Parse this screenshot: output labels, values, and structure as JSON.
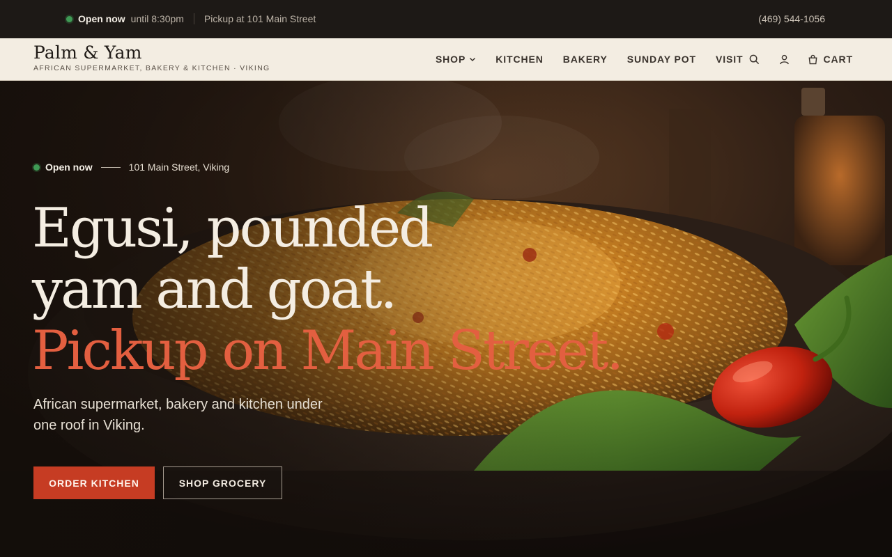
{
  "topbar": {
    "status_open": "Open now",
    "status_until": "until 8:30pm",
    "pickup": "Pickup at 101 Main Street",
    "phone": "(469) 544-1056"
  },
  "header": {
    "brand_name": "Palm & Yam",
    "brand_tagline": "AFRICAN SUPERMARKET, BAKERY & KITCHEN · VIKING",
    "nav": {
      "shop": "SHOP",
      "kitchen": "KITCHEN",
      "bakery": "BAKERY",
      "sunday_pot": "SUNDAY POT",
      "visit": "VISIT",
      "cart": "CART"
    }
  },
  "hero": {
    "eyebrow_open": "Open now",
    "eyebrow_address": "101 Main Street, Viking",
    "headline_line1": "Egusi, pounded",
    "headline_line2": "yam and goat.",
    "headline_accent": "Pickup on Main Street.",
    "lede": "African supermarket, bakery and kitchen under one roof in Viking.",
    "cta_primary": "ORDER KITCHEN",
    "cta_secondary": "SHOP GROCERY"
  },
  "colors": {
    "accent": "#e35f40",
    "primary_button": "#c63c23",
    "open_dot": "#3f9a55",
    "header_bg": "#f3ede2",
    "topbar_bg": "#1d1916"
  },
  "icons": [
    "status-dot",
    "chevron-down-icon",
    "search-icon",
    "user-icon",
    "shopping-bag-icon"
  ]
}
